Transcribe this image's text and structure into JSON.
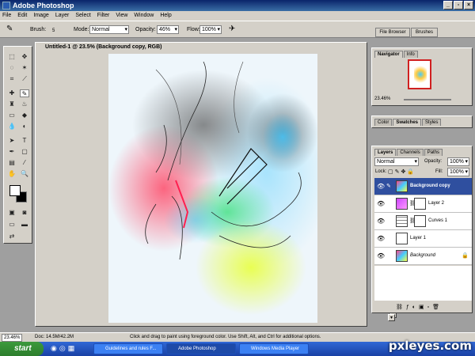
{
  "window": {
    "title": "Adobe Photoshop"
  },
  "menu": [
    "File",
    "Edit",
    "Image",
    "Layer",
    "Select",
    "Filter",
    "View",
    "Window",
    "Help"
  ],
  "options": {
    "brush_label": "Brush:",
    "brush_size": "5",
    "mode_label": "Mode:",
    "mode_value": "Normal",
    "opacity_label": "Opacity:",
    "opacity_value": "46%",
    "flow_label": "Flow:",
    "flow_value": "100%",
    "file_browser": "File Browser",
    "brushes": "Brushes"
  },
  "document": {
    "title": "Untitled-1 @ 23.5% (Background copy, RGB)"
  },
  "navigator": {
    "tabs": [
      "Navigator",
      "Info"
    ],
    "zoom": "23.46%"
  },
  "swatches": {
    "tabs": [
      "Color",
      "Swatches",
      "Styles"
    ]
  },
  "layers_panel": {
    "tabs": [
      "Layers",
      "Channels",
      "Paths"
    ],
    "blend": "Normal",
    "opacity_label": "Opacity:",
    "opacity_value": "100%",
    "lock_label": "Lock:",
    "fill_label": "Fill:",
    "fill_value": "100%",
    "layers": [
      {
        "name": "Background copy"
      },
      {
        "name": "Layer 2"
      },
      {
        "name": "Curves 1"
      },
      {
        "name": "Layer 1"
      },
      {
        "name": "Background"
      }
    ]
  },
  "status": {
    "zoom": "23.46%",
    "doc": "Doc: 14.5M/42.2M",
    "hint": "Click and drag to paint using foreground color. Use Shift, Alt, and Ctrl for additional options."
  },
  "taskbar": {
    "start": "start",
    "tasks": [
      "Guidelines and rules F...",
      "Adobe Photoshop",
      "Windows Media Player"
    ]
  },
  "watermark": "pxleyes.com"
}
